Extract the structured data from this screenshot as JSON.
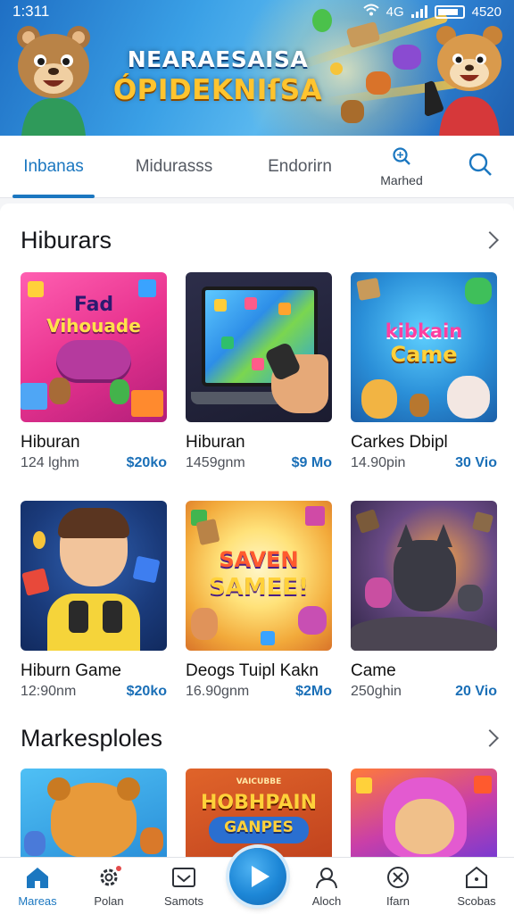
{
  "status_bar": {
    "time": "1:311",
    "right_text": "4520",
    "network_text": "4G"
  },
  "hero": {
    "title_line1": "NEARAESAISA",
    "title_line2": "ÓPIDEKNIſSA"
  },
  "tabs": [
    {
      "label": "Inbanas",
      "active": true
    },
    {
      "label": "Midurasss",
      "active": false
    },
    {
      "label": "Endorirn",
      "active": false
    },
    {
      "label": "Marhed",
      "icon": "search-icon",
      "active": false
    },
    {
      "label": "",
      "icon": "search-icon",
      "active": false
    }
  ],
  "section1": {
    "title": "Hiburars",
    "cards": [
      {
        "title": "Hiburan",
        "meta": "124 lghm",
        "price": "$20ko",
        "art_text": [
          "Fad",
          "Vihouade"
        ]
      },
      {
        "title": "Hiburan",
        "meta": "1459gnm",
        "price": "$9 Mo",
        "art_text": []
      },
      {
        "title": "Carkes Dbipl",
        "meta": "14.90pin",
        "price": "30 Vio",
        "art_text": [
          "kibkain",
          "Came"
        ]
      },
      {
        "title": "Hiburn Game",
        "meta": "12:90nm",
        "price": "$20ko",
        "art_text": []
      },
      {
        "title": "Deogs Tuipl Kakn",
        "meta": "16.90gnm",
        "price": "$2Mo",
        "art_text": [
          "SAVEN",
          "SAMEE!"
        ]
      },
      {
        "title": "Came",
        "meta": "250ghin",
        "price": "20 Vio",
        "art_text": []
      }
    ]
  },
  "section2": {
    "title": "Markesploles",
    "cards": [
      {
        "art_text": []
      },
      {
        "art_text": [
          "VAICUBBE",
          "HOBHPAIN",
          "GANPES"
        ]
      },
      {
        "art_text": []
      }
    ]
  },
  "bottom_nav": [
    {
      "label": "Mareas",
      "icon": "home-icon",
      "active": true
    },
    {
      "label": "Polan",
      "icon": "settings-gear-icon",
      "active": false
    },
    {
      "label": "Samots",
      "icon": "inbox-icon",
      "active": false
    },
    {
      "label": "",
      "icon": "play-icon",
      "active": false
    },
    {
      "label": "Aloch",
      "icon": "profile-icon",
      "active": false
    },
    {
      "label": "Ifarn",
      "icon": "compass-icon",
      "active": false
    },
    {
      "label": "Scobas",
      "icon": "shop-icon",
      "active": false
    }
  ],
  "colors": {
    "accent": "#1b77c0",
    "price": "#1a6fb7",
    "hero_title_gold": "#ffc42e"
  }
}
